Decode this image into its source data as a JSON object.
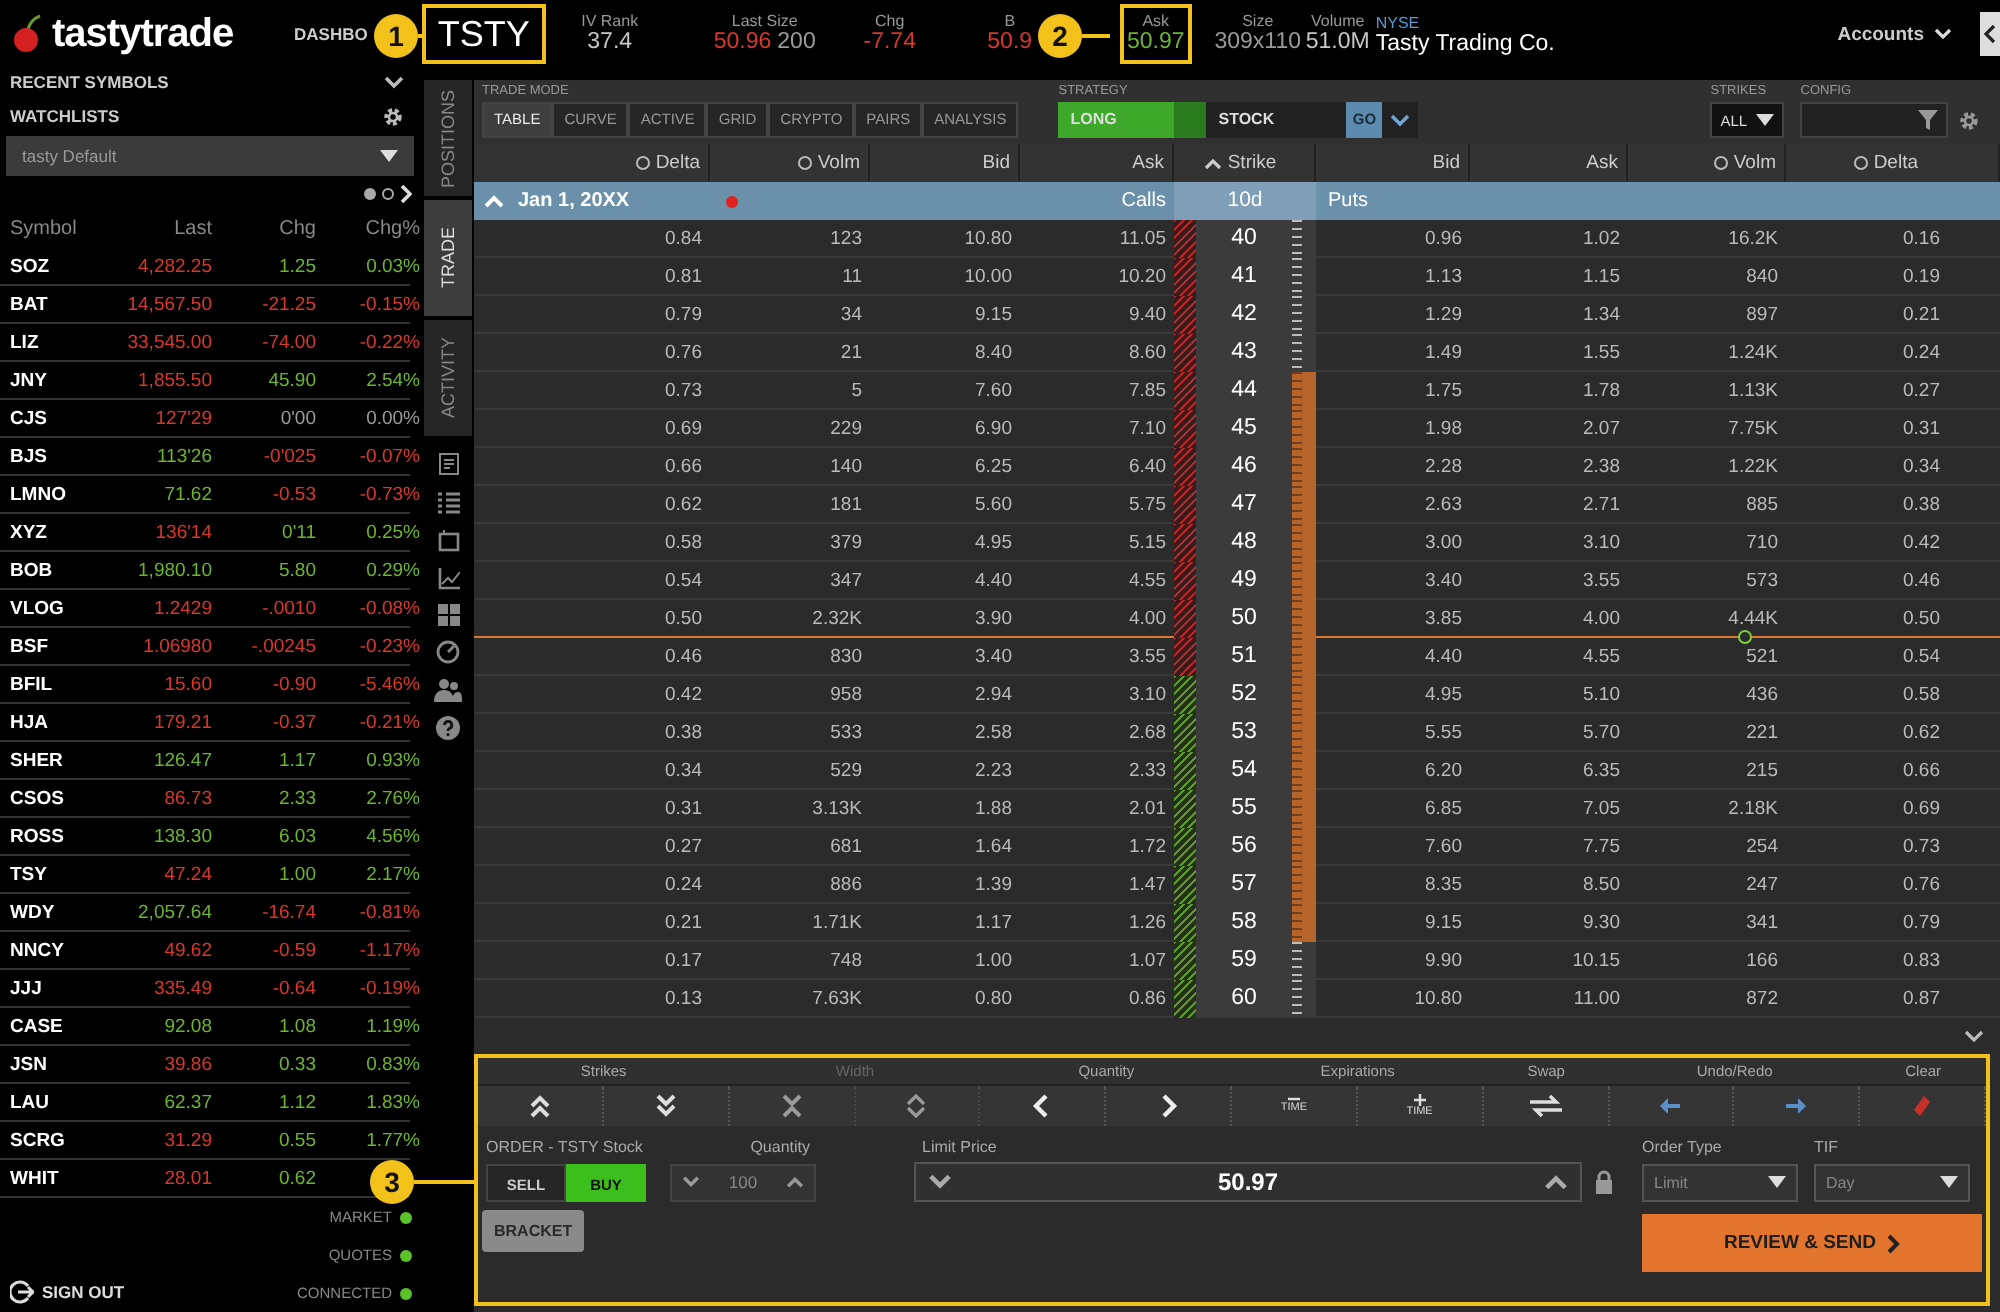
{
  "app": {
    "logo": "tastytrade",
    "nav": "DASHBO"
  },
  "symbol": {
    "text": "TSTY",
    "highlighted": true
  },
  "quote": [
    {
      "label": "IV Rank",
      "highlighted": false,
      "values": [
        {
          "text": "37.4",
          "color": "#c8c8c8"
        }
      ]
    },
    {
      "label": "Last Size",
      "highlighted": false,
      "values": [
        {
          "text": "50.96",
          "color": "#d8382b"
        },
        {
          "text": "200",
          "color": "#9a9a9a"
        }
      ]
    },
    {
      "label": "Chg",
      "highlighted": false,
      "values": [
        {
          "text": "-7.74",
          "color": "#d8382b"
        }
      ]
    },
    {
      "label": "B",
      "highlighted": false,
      "values": [
        {
          "text": "50.9",
          "color": "#d8382b"
        }
      ]
    },
    {
      "label": "Ask",
      "highlighted": true,
      "values": [
        {
          "text": "50.97",
          "color": "#6cb52f"
        }
      ]
    },
    {
      "label": "Size",
      "highlighted": false,
      "values": [
        {
          "text": "309x110",
          "color": "#9a9a9a"
        }
      ]
    },
    {
      "label": "Volume",
      "highlighted": false,
      "values": [
        {
          "text": "51.0M",
          "color": "#c8c8c8"
        }
      ]
    }
  ],
  "company": {
    "exchange": "NYSE",
    "name": "Tasty Trading Co."
  },
  "accounts": "Accounts",
  "callouts": [
    {
      "number": "1"
    },
    {
      "number": "2"
    },
    {
      "number": "3"
    }
  ],
  "sidebar": {
    "recent": "RECENT SYMBOLS",
    "watchlists": "WATCHLISTS",
    "watchlist": "tasty Default",
    "pages": [
      {
        "selected": true
      },
      {
        "selected": false
      }
    ],
    "columns": [
      "Symbol",
      "Last",
      "Chg",
      "Chg%"
    ],
    "rows": [
      {
        "symbol": "SOZ",
        "last": {
          "text": "4,282.25",
          "color": "#d8382b"
        },
        "chg": {
          "text": "1.25",
          "color": "#6cb52f"
        },
        "chg_pct": {
          "text": "0.03%",
          "color": "#6cb52f"
        }
      },
      {
        "symbol": "BAT",
        "last": {
          "text": "14,567.50",
          "color": "#d8382b"
        },
        "chg": {
          "text": "-21.25",
          "color": "#d8382b"
        },
        "chg_pct": {
          "text": "-0.15%",
          "color": "#d8382b"
        }
      },
      {
        "symbol": "LIZ",
        "last": {
          "text": "33,545.00",
          "color": "#d8382b"
        },
        "chg": {
          "text": "-74.00",
          "color": "#d8382b"
        },
        "chg_pct": {
          "text": "-0.22%",
          "color": "#d8382b"
        }
      },
      {
        "symbol": "JNY",
        "last": {
          "text": "1,855.50",
          "color": "#d8382b"
        },
        "chg": {
          "text": "45.90",
          "color": "#6cb52f"
        },
        "chg_pct": {
          "text": "2.54%",
          "color": "#6cb52f"
        }
      },
      {
        "symbol": "CJS",
        "last": {
          "text": "127'29",
          "color": "#d8382b"
        },
        "chg": {
          "text": "0'00",
          "color": "#9a9a9a"
        },
        "chg_pct": {
          "text": "0.00%",
          "color": "#9a9a9a"
        }
      },
      {
        "symbol": "BJS",
        "last": {
          "text": "113'26",
          "color": "#6cb52f"
        },
        "chg": {
          "text": "-0'025",
          "color": "#d8382b"
        },
        "chg_pct": {
          "text": "-0.07%",
          "color": "#d8382b"
        }
      },
      {
        "symbol": "LMNO",
        "last": {
          "text": "71.62",
          "color": "#6cb52f"
        },
        "chg": {
          "text": "-0.53",
          "color": "#d8382b"
        },
        "chg_pct": {
          "text": "-0.73%",
          "color": "#d8382b"
        }
      },
      {
        "symbol": "XYZ",
        "last": {
          "text": "136'14",
          "color": "#d8382b"
        },
        "chg": {
          "text": "0'11",
          "color": "#6cb52f"
        },
        "chg_pct": {
          "text": "0.25%",
          "color": "#6cb52f"
        }
      },
      {
        "symbol": "BOB",
        "last": {
          "text": "1,980.10",
          "color": "#6cb52f"
        },
        "chg": {
          "text": "5.80",
          "color": "#6cb52f"
        },
        "chg_pct": {
          "text": "0.29%",
          "color": "#6cb52f"
        }
      },
      {
        "symbol": "VLOG",
        "last": {
          "text": "1.2429",
          "color": "#d8382b"
        },
        "chg": {
          "text": "-.0010",
          "color": "#d8382b"
        },
        "chg_pct": {
          "text": "-0.08%",
          "color": "#d8382b"
        }
      },
      {
        "symbol": "BSF",
        "last": {
          "text": "1.06980",
          "color": "#d8382b"
        },
        "chg": {
          "text": "-.00245",
          "color": "#d8382b"
        },
        "chg_pct": {
          "text": "-0.23%",
          "color": "#d8382b"
        }
      },
      {
        "symbol": "BFIL",
        "last": {
          "text": "15.60",
          "color": "#d8382b"
        },
        "chg": {
          "text": "-0.90",
          "color": "#d8382b"
        },
        "chg_pct": {
          "text": "-5.46%",
          "color": "#d8382b"
        }
      },
      {
        "symbol": "HJA",
        "last": {
          "text": "179.21",
          "color": "#d8382b"
        },
        "chg": {
          "text": "-0.37",
          "color": "#d8382b"
        },
        "chg_pct": {
          "text": "-0.21%",
          "color": "#d8382b"
        }
      },
      {
        "symbol": "SHER",
        "last": {
          "text": "126.47",
          "color": "#6cb52f"
        },
        "chg": {
          "text": "1.17",
          "color": "#6cb52f"
        },
        "chg_pct": {
          "text": "0.93%",
          "color": "#6cb52f"
        }
      },
      {
        "symbol": "CSOS",
        "last": {
          "text": "86.73",
          "color": "#d8382b"
        },
        "chg": {
          "text": "2.33",
          "color": "#6cb52f"
        },
        "chg_pct": {
          "text": "2.76%",
          "color": "#6cb52f"
        }
      },
      {
        "symbol": "ROSS",
        "last": {
          "text": "138.30",
          "color": "#6cb52f"
        },
        "chg": {
          "text": "6.03",
          "color": "#6cb52f"
        },
        "chg_pct": {
          "text": "4.56%",
          "color": "#6cb52f"
        }
      },
      {
        "symbol": "TSY",
        "last": {
          "text": "47.24",
          "color": "#d8382b"
        },
        "chg": {
          "text": "1.00",
          "color": "#6cb52f"
        },
        "chg_pct": {
          "text": "2.17%",
          "color": "#6cb52f"
        }
      },
      {
        "symbol": "WDY",
        "last": {
          "text": "2,057.64",
          "color": "#6cb52f"
        },
        "chg": {
          "text": "-16.74",
          "color": "#d8382b"
        },
        "chg_pct": {
          "text": "-0.81%",
          "color": "#d8382b"
        }
      },
      {
        "symbol": "NNCY",
        "last": {
          "text": "49.62",
          "color": "#d8382b"
        },
        "chg": {
          "text": "-0.59",
          "color": "#d8382b"
        },
        "chg_pct": {
          "text": "-1.17%",
          "color": "#d8382b"
        }
      },
      {
        "symbol": "JJJ",
        "last": {
          "text": "335.49",
          "color": "#d8382b"
        },
        "chg": {
          "text": "-0.64",
          "color": "#d8382b"
        },
        "chg_pct": {
          "text": "-0.19%",
          "color": "#d8382b"
        }
      },
      {
        "symbol": "CASE",
        "last": {
          "text": "92.08",
          "color": "#6cb52f"
        },
        "chg": {
          "text": "1.08",
          "color": "#6cb52f"
        },
        "chg_pct": {
          "text": "1.19%",
          "color": "#6cb52f"
        }
      },
      {
        "symbol": "JSN",
        "last": {
          "text": "39.86",
          "color": "#d8382b"
        },
        "chg": {
          "text": "0.33",
          "color": "#6cb52f"
        },
        "chg_pct": {
          "text": "0.83%",
          "color": "#6cb52f"
        }
      },
      {
        "symbol": "LAU",
        "last": {
          "text": "62.37",
          "color": "#6cb52f"
        },
        "chg": {
          "text": "1.12",
          "color": "#6cb52f"
        },
        "chg_pct": {
          "text": "1.83%",
          "color": "#6cb52f"
        }
      },
      {
        "symbol": "SCRG",
        "last": {
          "text": "31.29",
          "color": "#d8382b"
        },
        "chg": {
          "text": "0.55",
          "color": "#6cb52f"
        },
        "chg_pct": {
          "text": "1.77%",
          "color": "#6cb52f"
        }
      },
      {
        "symbol": "WHIT",
        "last": {
          "text": "28.01",
          "color": "#d8382b"
        },
        "chg": {
          "text": "0.62",
          "color": "#6cb52f"
        }
      }
    ],
    "status": [
      {
        "label": "MARKET",
        "ok": true
      },
      {
        "label": "QUOTES",
        "ok": true
      },
      {
        "label": "CONNECTED",
        "ok": true
      }
    ],
    "sign_out": "SIGN OUT"
  },
  "side_tabs": [
    {
      "label": "POSITIONS",
      "selected": false
    },
    {
      "label": "TRADE",
      "selected": true
    },
    {
      "label": "ACTIVITY",
      "selected": false
    }
  ],
  "trade_mode": {
    "label": "TRADE MODE",
    "tabs": [
      {
        "label": "TABLE",
        "selected": true
      },
      {
        "label": "CURVE",
        "selected": false
      },
      {
        "label": "ACTIVE",
        "selected": false
      },
      {
        "label": "GRID",
        "selected": false
      },
      {
        "label": "CRYPTO",
        "selected": false
      },
      {
        "label": "PAIRS",
        "selected": false
      },
      {
        "label": "ANALYSIS",
        "selected": false
      }
    ]
  },
  "strategy": {
    "label": "STRATEGY",
    "direction": "LONG",
    "direction_on": true,
    "type": "STOCK",
    "go": "GO"
  },
  "strikes": {
    "label": "STRIKES",
    "value": "ALL"
  },
  "config": {
    "label": "CONFIG"
  },
  "chain": {
    "columns": [
      "Delta",
      "Volm",
      "Bid",
      "Ask",
      "Strike",
      "Bid",
      "Ask",
      "Volm",
      "Delta"
    ],
    "expiration": {
      "date": "Jan 1, 20XX",
      "expanded": true,
      "alert": true,
      "calls": "Calls",
      "dte": "10d",
      "puts": "Puts"
    },
    "rows": [
      {
        "strike": "40",
        "call": [
          "0.84",
          "123",
          "10.80",
          "11.05"
        ],
        "put": [
          "0.96",
          "1.02",
          "16.2K",
          "0.16"
        ],
        "calls_itm": true,
        "in_range": false,
        "price_line_below": false
      },
      {
        "strike": "41",
        "call": [
          "0.81",
          "11",
          "10.00",
          "10.20"
        ],
        "put": [
          "1.13",
          "1.15",
          "840",
          "0.19"
        ],
        "calls_itm": true,
        "in_range": false,
        "price_line_below": false
      },
      {
        "strike": "42",
        "call": [
          "0.79",
          "34",
          "9.15",
          "9.40"
        ],
        "put": [
          "1.29",
          "1.34",
          "897",
          "0.21"
        ],
        "calls_itm": true,
        "in_range": false,
        "price_line_below": false
      },
      {
        "strike": "43",
        "call": [
          "0.76",
          "21",
          "8.40",
          "8.60"
        ],
        "put": [
          "1.49",
          "1.55",
          "1.24K",
          "0.24"
        ],
        "calls_itm": true,
        "in_range": false,
        "price_line_below": false
      },
      {
        "strike": "44",
        "call": [
          "0.73",
          "5",
          "7.60",
          "7.85"
        ],
        "put": [
          "1.75",
          "1.78",
          "1.13K",
          "0.27"
        ],
        "calls_itm": true,
        "in_range": true,
        "price_line_below": false
      },
      {
        "strike": "45",
        "call": [
          "0.69",
          "229",
          "6.90",
          "7.10"
        ],
        "put": [
          "1.98",
          "2.07",
          "7.75K",
          "0.31"
        ],
        "calls_itm": true,
        "in_range": true,
        "price_line_below": false
      },
      {
        "strike": "46",
        "call": [
          "0.66",
          "140",
          "6.25",
          "6.40"
        ],
        "put": [
          "2.28",
          "2.38",
          "1.22K",
          "0.34"
        ],
        "calls_itm": true,
        "in_range": true,
        "price_line_below": false
      },
      {
        "strike": "47",
        "call": [
          "0.62",
          "181",
          "5.60",
          "5.75"
        ],
        "put": [
          "2.63",
          "2.71",
          "885",
          "0.38"
        ],
        "calls_itm": true,
        "in_range": true,
        "price_line_below": false
      },
      {
        "strike": "48",
        "call": [
          "0.58",
          "379",
          "4.95",
          "5.15"
        ],
        "put": [
          "3.00",
          "3.10",
          "710",
          "0.42"
        ],
        "calls_itm": true,
        "in_range": true,
        "price_line_below": false
      },
      {
        "strike": "49",
        "call": [
          "0.54",
          "347",
          "4.40",
          "4.55"
        ],
        "put": [
          "3.40",
          "3.55",
          "573",
          "0.46"
        ],
        "calls_itm": true,
        "in_range": true,
        "price_line_below": false
      },
      {
        "strike": "50",
        "call": [
          "0.50",
          "2.32K",
          "3.90",
          "4.00"
        ],
        "put": [
          "3.85",
          "4.00",
          "4.44K",
          "0.50"
        ],
        "calls_itm": true,
        "in_range": true,
        "price_line_below": true
      },
      {
        "strike": "51",
        "call": [
          "0.46",
          "830",
          "3.40",
          "3.55"
        ],
        "put": [
          "4.40",
          "4.55",
          "521",
          "0.54"
        ],
        "calls_itm": true,
        "in_range": true,
        "price_line_below": false
      },
      {
        "strike": "52",
        "call": [
          "0.42",
          "958",
          "2.94",
          "3.10"
        ],
        "put": [
          "4.95",
          "5.10",
          "436",
          "0.58"
        ],
        "calls_itm": false,
        "in_range": true,
        "price_line_below": false
      },
      {
        "strike": "53",
        "call": [
          "0.38",
          "533",
          "2.58",
          "2.68"
        ],
        "put": [
          "5.55",
          "5.70",
          "221",
          "0.62"
        ],
        "calls_itm": false,
        "in_range": true,
        "price_line_below": false
      },
      {
        "strike": "54",
        "call": [
          "0.34",
          "529",
          "2.23",
          "2.33"
        ],
        "put": [
          "6.20",
          "6.35",
          "215",
          "0.66"
        ],
        "calls_itm": false,
        "in_range": true,
        "price_line_below": false
      },
      {
        "strike": "55",
        "call": [
          "0.31",
          "3.13K",
          "1.88",
          "2.01"
        ],
        "put": [
          "6.85",
          "7.05",
          "2.18K",
          "0.69"
        ],
        "calls_itm": false,
        "in_range": true,
        "price_line_below": false
      },
      {
        "strike": "56",
        "call": [
          "0.27",
          "681",
          "1.64",
          "1.72"
        ],
        "put": [
          "7.60",
          "7.75",
          "254",
          "0.73"
        ],
        "calls_itm": false,
        "in_range": true,
        "price_line_below": false
      },
      {
        "strike": "57",
        "call": [
          "0.24",
          "886",
          "1.39",
          "1.47"
        ],
        "put": [
          "8.35",
          "8.50",
          "247",
          "0.76"
        ],
        "calls_itm": false,
        "in_range": true,
        "price_line_below": false
      },
      {
        "strike": "58",
        "call": [
          "0.21",
          "1.71K",
          "1.17",
          "1.26"
        ],
        "put": [
          "9.15",
          "9.30",
          "341",
          "0.79"
        ],
        "calls_itm": false,
        "in_range": true,
        "price_line_below": false
      },
      {
        "strike": "59",
        "call": [
          "0.17",
          "748",
          "1.00",
          "1.07"
        ],
        "put": [
          "9.90",
          "10.15",
          "166",
          "0.83"
        ],
        "calls_itm": false,
        "in_range": false,
        "price_line_below": false
      },
      {
        "strike": "60",
        "call": [
          "0.13",
          "7.63K",
          "0.80",
          "0.86"
        ],
        "put": [
          "10.80",
          "11.00",
          "872",
          "0.87"
        ],
        "calls_itm": false,
        "in_range": false,
        "price_line_below": false
      }
    ]
  },
  "order": {
    "highlighted": true,
    "toolbar": [
      {
        "label": "Strikes",
        "disabled": false,
        "buttons": [
          {
            "kind": "double-up"
          },
          {
            "kind": "double-down"
          }
        ]
      },
      {
        "label": "Width",
        "disabled": true,
        "buttons": [
          {
            "kind": "collapse"
          },
          {
            "kind": "expand"
          }
        ]
      },
      {
        "label": "Quantity",
        "disabled": false,
        "buttons": [
          {
            "kind": "left"
          },
          {
            "kind": "right"
          }
        ]
      },
      {
        "label": "Expirations",
        "disabled": false,
        "buttons": [
          {
            "kind": "minus",
            "label": "TIME"
          },
          {
            "kind": "plus",
            "label": "TIME"
          }
        ]
      },
      {
        "label": "Swap",
        "disabled": false,
        "buttons": [
          {
            "kind": "swap"
          }
        ]
      },
      {
        "label": "Undo/Redo",
        "disabled": false,
        "buttons": [
          {
            "kind": "undo"
          },
          {
            "kind": "redo"
          }
        ]
      },
      {
        "label": "Clear",
        "disabled": false,
        "buttons": [
          {
            "kind": "clear"
          }
        ]
      }
    ],
    "title": "ORDER - TSTY Stock",
    "quantity_label": "Quantity",
    "sides": [
      {
        "label": "SELL",
        "selected": false
      },
      {
        "label": "BUY",
        "selected": true
      }
    ],
    "quantity": "100",
    "price_label": "Limit Price",
    "price": "50.97",
    "order_type_label": "Order Type",
    "order_type": "Limit",
    "tif_label": "TIF",
    "tif": "Day",
    "bracket": "BRACKET",
    "submit": "REVIEW & SEND"
  }
}
